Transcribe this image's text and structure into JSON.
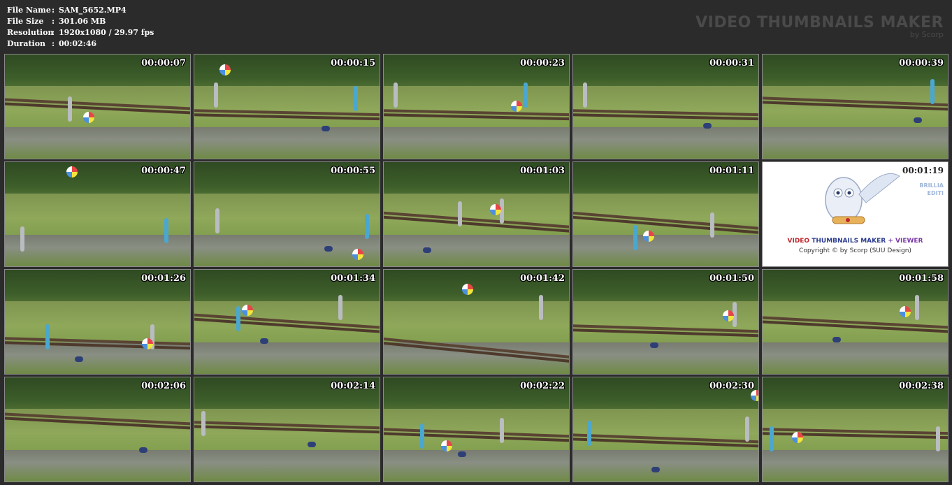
{
  "info": {
    "file_name_label": "File Name",
    "file_name_value": "SAM_5652.MP4",
    "file_size_label": "File Size",
    "file_size_value": "301.06 MB",
    "resolution_label": "Resolution",
    "resolution_value": "1920x1080 / 29.97 fps",
    "duration_label": "Duration",
    "duration_value": "00:02:46",
    "separator": ":"
  },
  "brand": {
    "title": "VIDEO THUMBNAILS MAKER",
    "byline": "by Scorp"
  },
  "thumbnails": [
    {
      "time": "00:00:07"
    },
    {
      "time": "00:00:15"
    },
    {
      "time": "00:00:23"
    },
    {
      "time": "00:00:31"
    },
    {
      "time": "00:00:39"
    },
    {
      "time": "00:00:47"
    },
    {
      "time": "00:00:55"
    },
    {
      "time": "00:01:03"
    },
    {
      "time": "00:01:11"
    },
    {
      "time": "00:01:19"
    },
    {
      "time": "00:01:26"
    },
    {
      "time": "00:01:34"
    },
    {
      "time": "00:01:42"
    },
    {
      "time": "00:01:50"
    },
    {
      "time": "00:01:58"
    },
    {
      "time": "00:02:06"
    },
    {
      "time": "00:02:14"
    },
    {
      "time": "00:02:22"
    },
    {
      "time": "00:02:30"
    },
    {
      "time": "00:02:38"
    }
  ],
  "promo": {
    "line1_a": "VIDEO",
    "line1_b": "THUMBNAILS MAKER",
    "line1_c": "+ VIEWER",
    "line2": "Copyright © by Scorp (SUU Design)",
    "side1": "BRILLIA",
    "side2": "EDITI"
  }
}
